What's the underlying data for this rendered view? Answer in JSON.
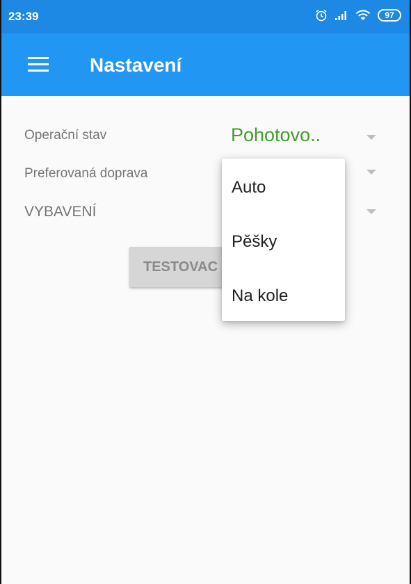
{
  "status_bar": {
    "time": "23:39",
    "battery": "97",
    "icons": [
      "alarm-icon",
      "signal-icon",
      "wifi-icon",
      "battery-icon"
    ]
  },
  "app_bar": {
    "title": "Nastavení",
    "menu_icon": "hamburger-menu-icon"
  },
  "settings": {
    "operational_state": {
      "label": "Operační stav",
      "value": "Pohotovo.."
    },
    "preferred_transport": {
      "label": "Preferovaná doprava"
    },
    "equipment": {
      "label": "VYBAVENÍ"
    }
  },
  "test_button": {
    "label": "TESTOVAC"
  },
  "dropdown": {
    "options": [
      "Auto",
      "Pěšky",
      "Na kole"
    ]
  },
  "colors": {
    "status_bar": "#1e88e5",
    "app_bar": "#2196f3",
    "value_green": "#3e9e2a",
    "background": "#fafafa"
  }
}
